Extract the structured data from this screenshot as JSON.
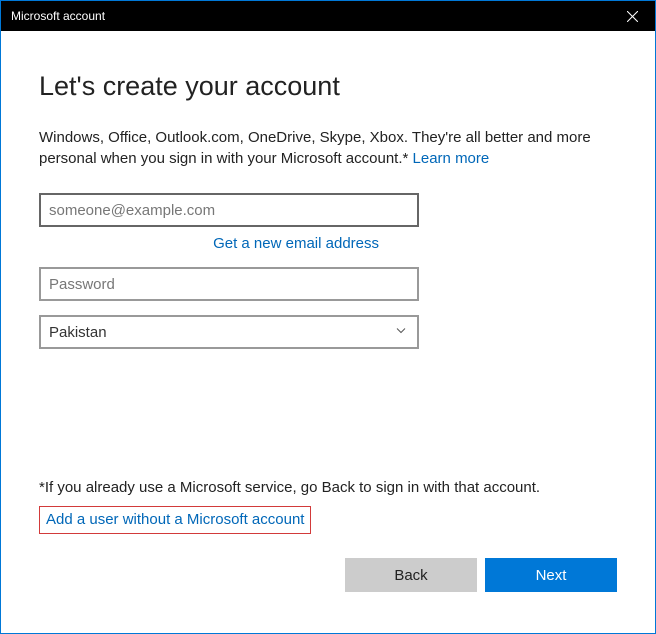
{
  "window": {
    "title": "Microsoft account"
  },
  "heading": "Let's create your account",
  "description_prefix": "Windows, Office, Outlook.com, OneDrive, Skype, Xbox. They're all better and more personal when you sign in with your Microsoft account.* ",
  "learn_more": "Learn more",
  "form": {
    "email_placeholder": "someone@example.com",
    "email_value": "",
    "get_new_email": "Get a new email address",
    "password_placeholder": "Password",
    "password_value": "",
    "country_value": "Pakistan"
  },
  "footnote": "*If you already use a Microsoft service, go Back to sign in with that account.",
  "alt_link": "Add a user without a Microsoft account",
  "buttons": {
    "back": "Back",
    "next": "Next"
  }
}
